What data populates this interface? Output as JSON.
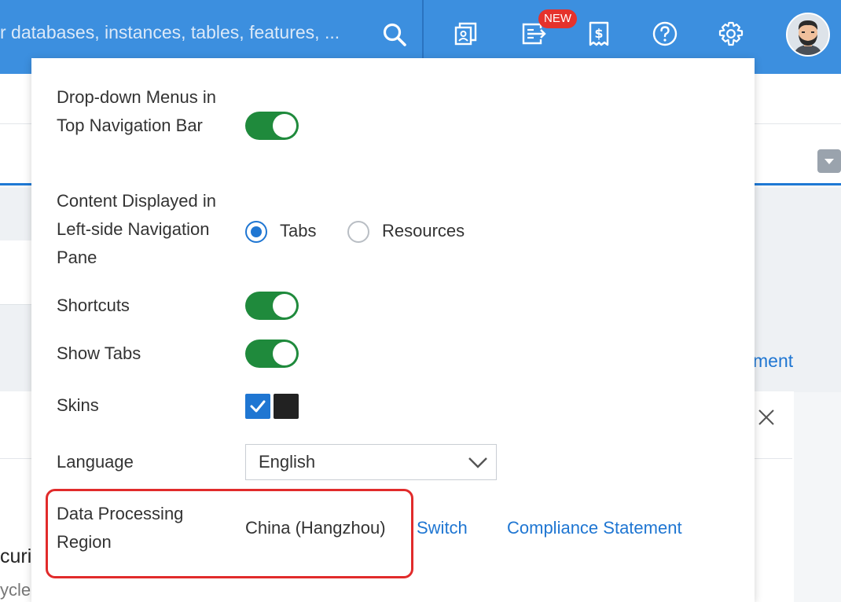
{
  "topbar": {
    "search_text": "r databases, instances, tables, features, ...",
    "icons": [
      "search-icon",
      "workspace-icon",
      "export-icon",
      "billing-icon",
      "help-icon",
      "gear-icon"
    ],
    "new_badge": "NEW"
  },
  "background": {
    "partial_link": "ment",
    "partial_heading": "curi",
    "partial_text": "ycle"
  },
  "settings": {
    "dropdown_menus_label": "Drop-down Menus in Top Navigation Bar",
    "dropdown_menus_on": true,
    "content_label": "Content Displayed in Left-side Navigation Pane",
    "content_options": [
      "Tabs",
      "Resources"
    ],
    "content_selected": "Tabs",
    "shortcuts_label": "Shortcuts",
    "shortcuts_on": true,
    "show_tabs_label": "Show Tabs",
    "show_tabs_on": true,
    "skins_label": "Skins",
    "skin_colors": [
      "#1f76d2",
      "#222222"
    ],
    "language_label": "Language",
    "language_value": "English",
    "region_label": "Data Processing Region",
    "region_value": "China (Hangzhou)",
    "switch_link": "Switch",
    "compliance_link": "Compliance Statement"
  },
  "colors": {
    "topbar": "#3c8fdf",
    "toggle_on": "#1f8a3c",
    "link": "#1f76d2",
    "highlight": "#e12b2b",
    "badge": "#e5322c"
  }
}
